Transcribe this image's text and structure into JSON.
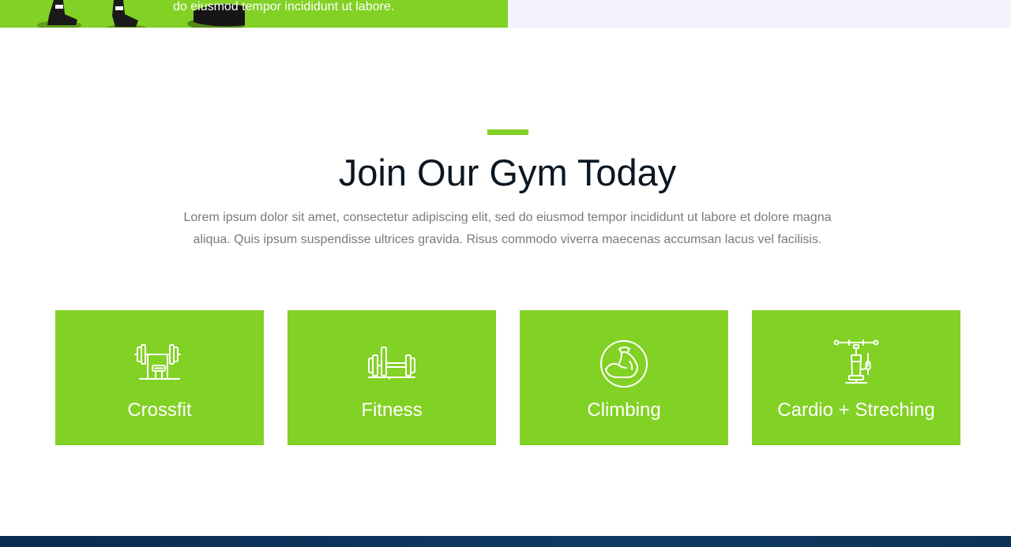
{
  "top_banner": {
    "text": "do eiusmod tempor incididunt ut labore.",
    "green": "#82d125",
    "pale": "#f3f4fb"
  },
  "section": {
    "accent_color": "#82d125",
    "title": "Join Our Gym Today",
    "description": "Lorem ipsum dolor sit amet, consectetur adipiscing elit, sed do eiusmod tempor incididunt ut labore et dolore magna aliqua. Quis ipsum suspendisse ultrices gravida. Risus commodo viverra maecenas accumsan lacus vel facilisis."
  },
  "cards": [
    {
      "label": "Crossfit",
      "icon": "barbell-bench-icon",
      "color": "#82d125"
    },
    {
      "label": "Fitness",
      "icon": "weight-bench-icon",
      "color": "#82d125"
    },
    {
      "label": "Climbing",
      "icon": "flexed-bicep-icon",
      "color": "#82d125"
    },
    {
      "label": "Cardio + Streching",
      "icon": "pump-icon",
      "color": "#82d125"
    }
  ],
  "footer": {
    "color": "#0d3258"
  }
}
